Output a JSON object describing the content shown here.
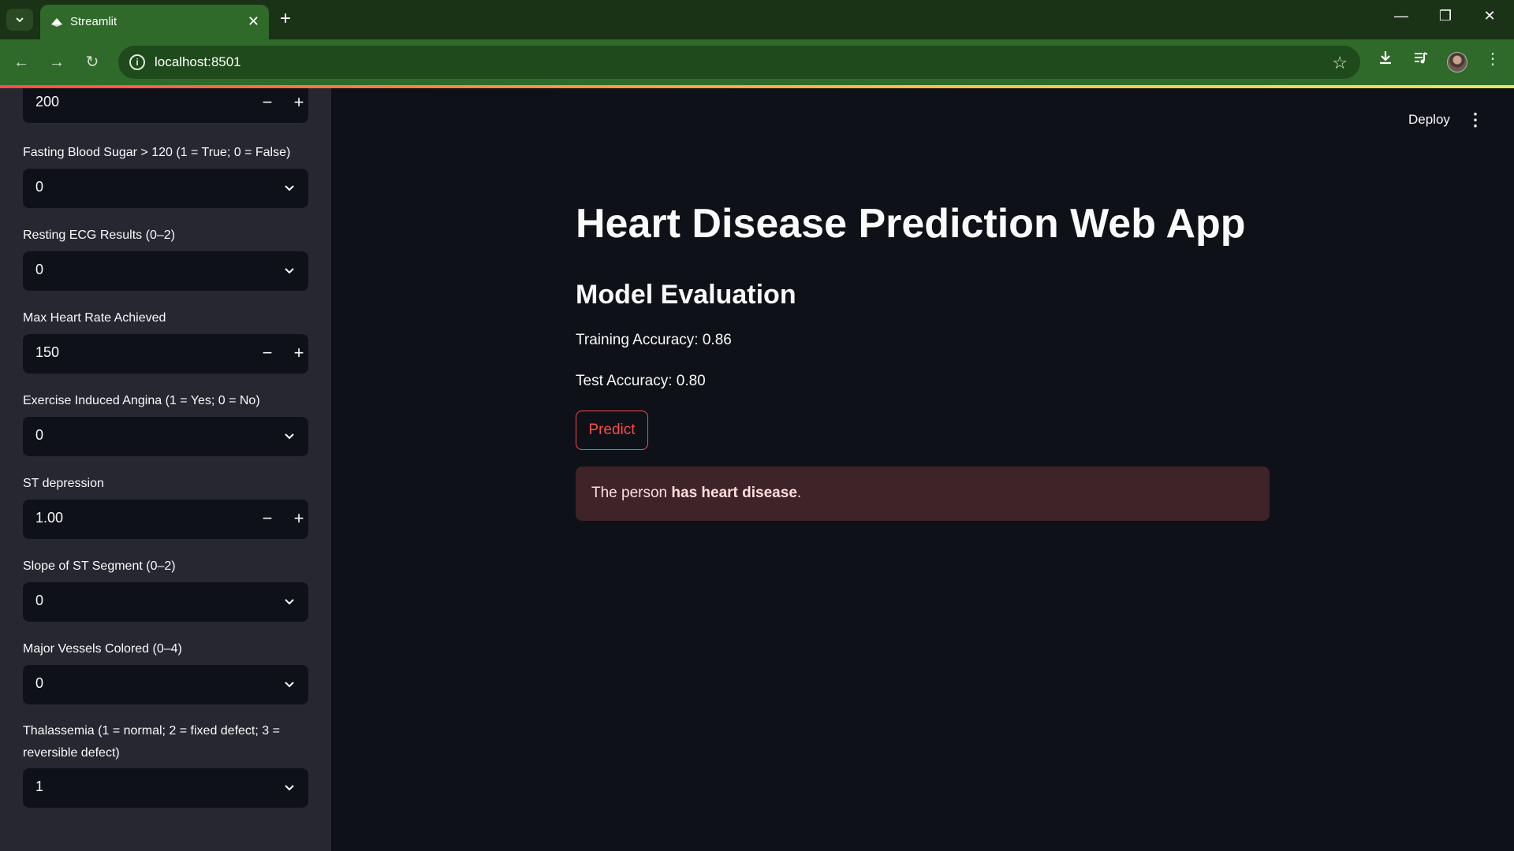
{
  "browser": {
    "tab_title": "Streamlit",
    "url": "localhost:8501",
    "icons": {
      "tab_menu": "chevron-down-icon",
      "tab_close": "close-icon",
      "new_tab": "plus-icon",
      "back": "arrow-left-icon",
      "forward": "arrow-right-icon",
      "reload": "reload-icon",
      "site_info": "info-icon",
      "bookmark": "star-icon",
      "download": "download-icon",
      "media": "media-control-icon",
      "profile": "avatar",
      "menu": "vertical-dots-icon"
    }
  },
  "sidebar": {
    "top_field": {
      "value": "200"
    },
    "widgets": [
      {
        "label": "Fasting Blood Sugar > 120 (1 = True; 0 = False)",
        "value": "0",
        "type": "select"
      },
      {
        "label": "Resting ECG Results (0–2)",
        "value": "0",
        "type": "select"
      },
      {
        "label": "Max Heart Rate Achieved",
        "value": "150",
        "type": "number"
      },
      {
        "label": "Exercise Induced Angina (1 = Yes; 0 = No)",
        "value": "0",
        "type": "select"
      },
      {
        "label": "ST depression",
        "value": "1.00",
        "type": "number"
      },
      {
        "label": "Slope of ST Segment (0–2)",
        "value": "0",
        "type": "select"
      },
      {
        "label": "Major Vessels Colored (0–4)",
        "value": "0",
        "type": "select"
      },
      {
        "label": "Thalassemia (1 = normal; 2 = fixed defect; 3 = reversible defect)",
        "value": "1",
        "type": "select"
      }
    ],
    "stepper_minus": "−",
    "stepper_plus": "+"
  },
  "main": {
    "deploy_label": "Deploy",
    "title": "Heart Disease Prediction Web App",
    "subheader": "Model Evaluation",
    "training_accuracy": "Training Accuracy: 0.86",
    "test_accuracy": "Test Accuracy: 0.80",
    "predict_label": "Predict",
    "result": {
      "prefix": "The person ",
      "emphasis": "has heart disease",
      "suffix": "."
    }
  },
  "colors": {
    "accent": "#ff4b4b",
    "sidebar_bg": "#262730",
    "app_bg": "#0e1117",
    "error_bg": "#3e2328",
    "chrome": "#2f6a2a"
  }
}
